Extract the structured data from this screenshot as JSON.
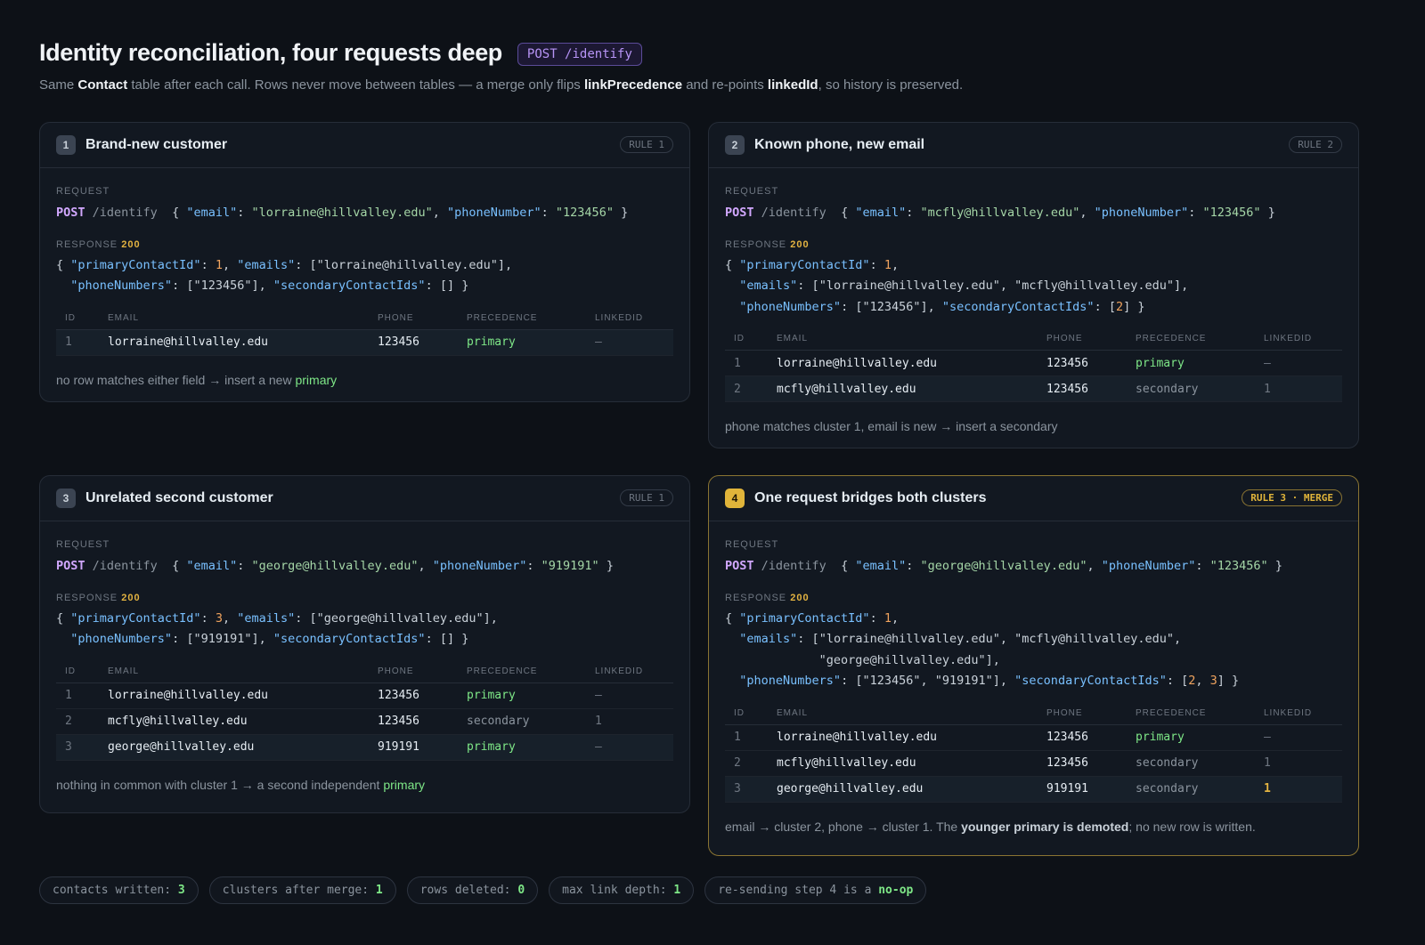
{
  "header": {
    "title": "Identity reconciliation, four requests deep",
    "endpoint": "POST /identify",
    "subtitle": {
      "p1": "Same ",
      "b1": "Contact",
      "p2": " table after each call. Rows never move between tables — a merge only flips ",
      "b2": "linkPrecedence",
      "p3": " and re-points ",
      "b3": "linkedId",
      "p4": ", so history is preserved."
    }
  },
  "labels": {
    "request": "REQUEST",
    "response": "RESPONSE",
    "status": "200",
    "method": "POST",
    "path": "/identify",
    "col_id": "ID",
    "col_email": "EMAIL",
    "col_phone": "PHONE",
    "col_precedence": "PRECEDENCE",
    "col_linkedid": "LINKEDID"
  },
  "cards": [
    {
      "num": "1",
      "title": "Brand-new customer",
      "rule": "RULE 1",
      "request_email": "\"lorraine@hillvalley.edu\"",
      "request_phone": "\"123456\"",
      "note": {
        "text": "no row matches either field → insert a new ",
        "hl": "primary"
      },
      "rows": [
        {
          "id": "1",
          "email": "lorraine@hillvalley.edu",
          "phone": "123456",
          "precedence": "primary",
          "linked": "–"
        }
      ]
    },
    {
      "num": "2",
      "title": "Known phone, new email",
      "rule": "RULE 2",
      "request_email": "\"mcfly@hillvalley.edu\"",
      "request_phone": "\"123456\"",
      "note": {
        "text": "phone matches cluster 1, email is new → insert a secondary"
      },
      "rows": [
        {
          "id": "1",
          "email": "lorraine@hillvalley.edu",
          "phone": "123456",
          "precedence": "primary",
          "linked": "–"
        },
        {
          "id": "2",
          "email": "mcfly@hillvalley.edu",
          "phone": "123456",
          "precedence": "secondary",
          "linked": "1"
        }
      ]
    },
    {
      "num": "3",
      "title": "Unrelated second customer",
      "rule": "RULE 1",
      "request_email": "\"george@hillvalley.edu\"",
      "request_phone": "\"919191\"",
      "note": {
        "text": "nothing in common with cluster 1 → a second independent ",
        "hl": "primary"
      },
      "rows": [
        {
          "id": "1",
          "email": "lorraine@hillvalley.edu",
          "phone": "123456",
          "precedence": "primary",
          "linked": "–"
        },
        {
          "id": "2",
          "email": "mcfly@hillvalley.edu",
          "phone": "123456",
          "precedence": "secondary",
          "linked": "1"
        },
        {
          "id": "3",
          "email": "george@hillvalley.edu",
          "phone": "919191",
          "precedence": "primary",
          "linked": "–"
        }
      ]
    },
    {
      "num": "4",
      "title": "One request bridges both clusters",
      "rule": "RULE 3 · MERGE",
      "request_email": "\"george@hillvalley.edu\"",
      "request_phone": "\"123456\"",
      "note": {
        "text": "email → cluster 2, phone → cluster 1. The ",
        "bold": "younger primary is demoted",
        "tail": "; no new row is written."
      },
      "rows": [
        {
          "id": "1",
          "email": "lorraine@hillvalley.edu",
          "phone": "123456",
          "precedence": "primary",
          "linked": "–"
        },
        {
          "id": "2",
          "email": "mcfly@hillvalley.edu",
          "phone": "123456",
          "precedence": "secondary",
          "linked": "1"
        },
        {
          "id": "3",
          "email": "george@hillvalley.edu",
          "phone": "919191",
          "precedence": "secondary",
          "linked": "1"
        }
      ]
    }
  ],
  "responses": {
    "r1": {
      "primary": "1",
      "emails": "\"lorraine@hillvalley.edu\"",
      "phones": "\"123456\""
    },
    "r2": {
      "primary": "1",
      "email1": "\"lorraine@hillvalley.edu\"",
      "email2": "\"mcfly@hillvalley.edu\"",
      "phones": "\"123456\"",
      "secondary": "2"
    },
    "r3": {
      "primary": "3",
      "emails": "\"george@hillvalley.edu\"",
      "phones": "\"919191\""
    },
    "r4": {
      "primary": "1",
      "email1": "\"lorraine@hillvalley.edu\"",
      "email2": "\"mcfly@hillvalley.edu\"",
      "email3": "\"george@hillvalley.edu\"",
      "phone1": "\"123456\"",
      "phone2": "\"919191\"",
      "sec1": "2",
      "sec2": "3"
    }
  },
  "keys": {
    "email": "\"email\"",
    "phoneNumber": "\"phoneNumber\"",
    "primaryContactId": "\"primaryContactId\"",
    "emails": "\"emails\"",
    "phoneNumbers": "\"phoneNumbers\"",
    "secondaryContactIds": "\"secondaryContactIds\""
  },
  "stats": [
    {
      "label": "contacts written: ",
      "value": "3"
    },
    {
      "label": "clusters after merge: ",
      "value": "1"
    },
    {
      "label": "rows deleted: ",
      "value": "0"
    },
    {
      "label": "max link depth: ",
      "value": "1"
    },
    {
      "label": "re-sending step 4 is a ",
      "value": "no-op"
    }
  ],
  "colors": {
    "background": "#0d1117",
    "primary": "#7ee787",
    "accent_merge": "#e0b43a",
    "key": "#79c0ff",
    "string": "#a5d6a7",
    "number": "#f0a35e"
  }
}
